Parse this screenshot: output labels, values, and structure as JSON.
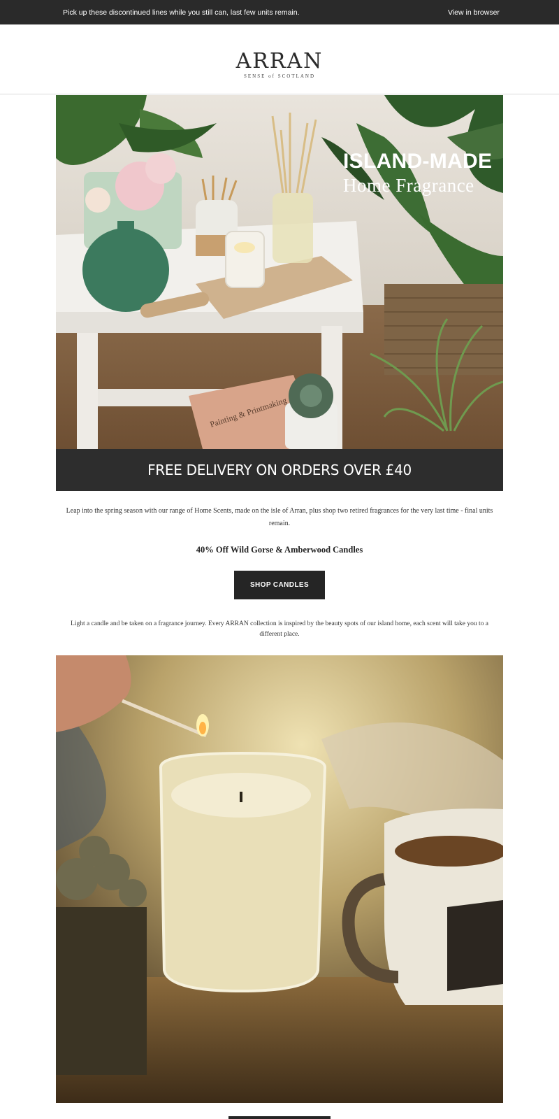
{
  "topbar": {
    "preheader": "Pick up these discontinued lines while you still can, last few units remain.",
    "view_in_browser": "View in browser"
  },
  "logo": {
    "wordmark": "ARRAN",
    "tagline": "SENSE of SCOTLAND"
  },
  "hero": {
    "headline": "ISLAND-MADE",
    "subheadline": "Home Fragrance",
    "book_title": "Painting & Printmaking"
  },
  "banner": {
    "text": "FREE DELIVERY ON ORDERS OVER £40"
  },
  "intro": {
    "text": "Leap into the spring season with our range of Home Scents, made on the isle of Arran, plus shop two retired fragrances for the very last time - final units remain."
  },
  "offer": {
    "text": "40% Off Wild Gorse & Amberwood Candles"
  },
  "cta": {
    "label": "SHOP CANDLES"
  },
  "journey": {
    "text": "Light a candle and be taken on a fragrance journey. Every ARRAN collection is inspired by the beauty spots of our island home, each scent will take you to a different place."
  },
  "colors": {
    "dark": "#2a2a2a",
    "white": "#ffffff"
  }
}
